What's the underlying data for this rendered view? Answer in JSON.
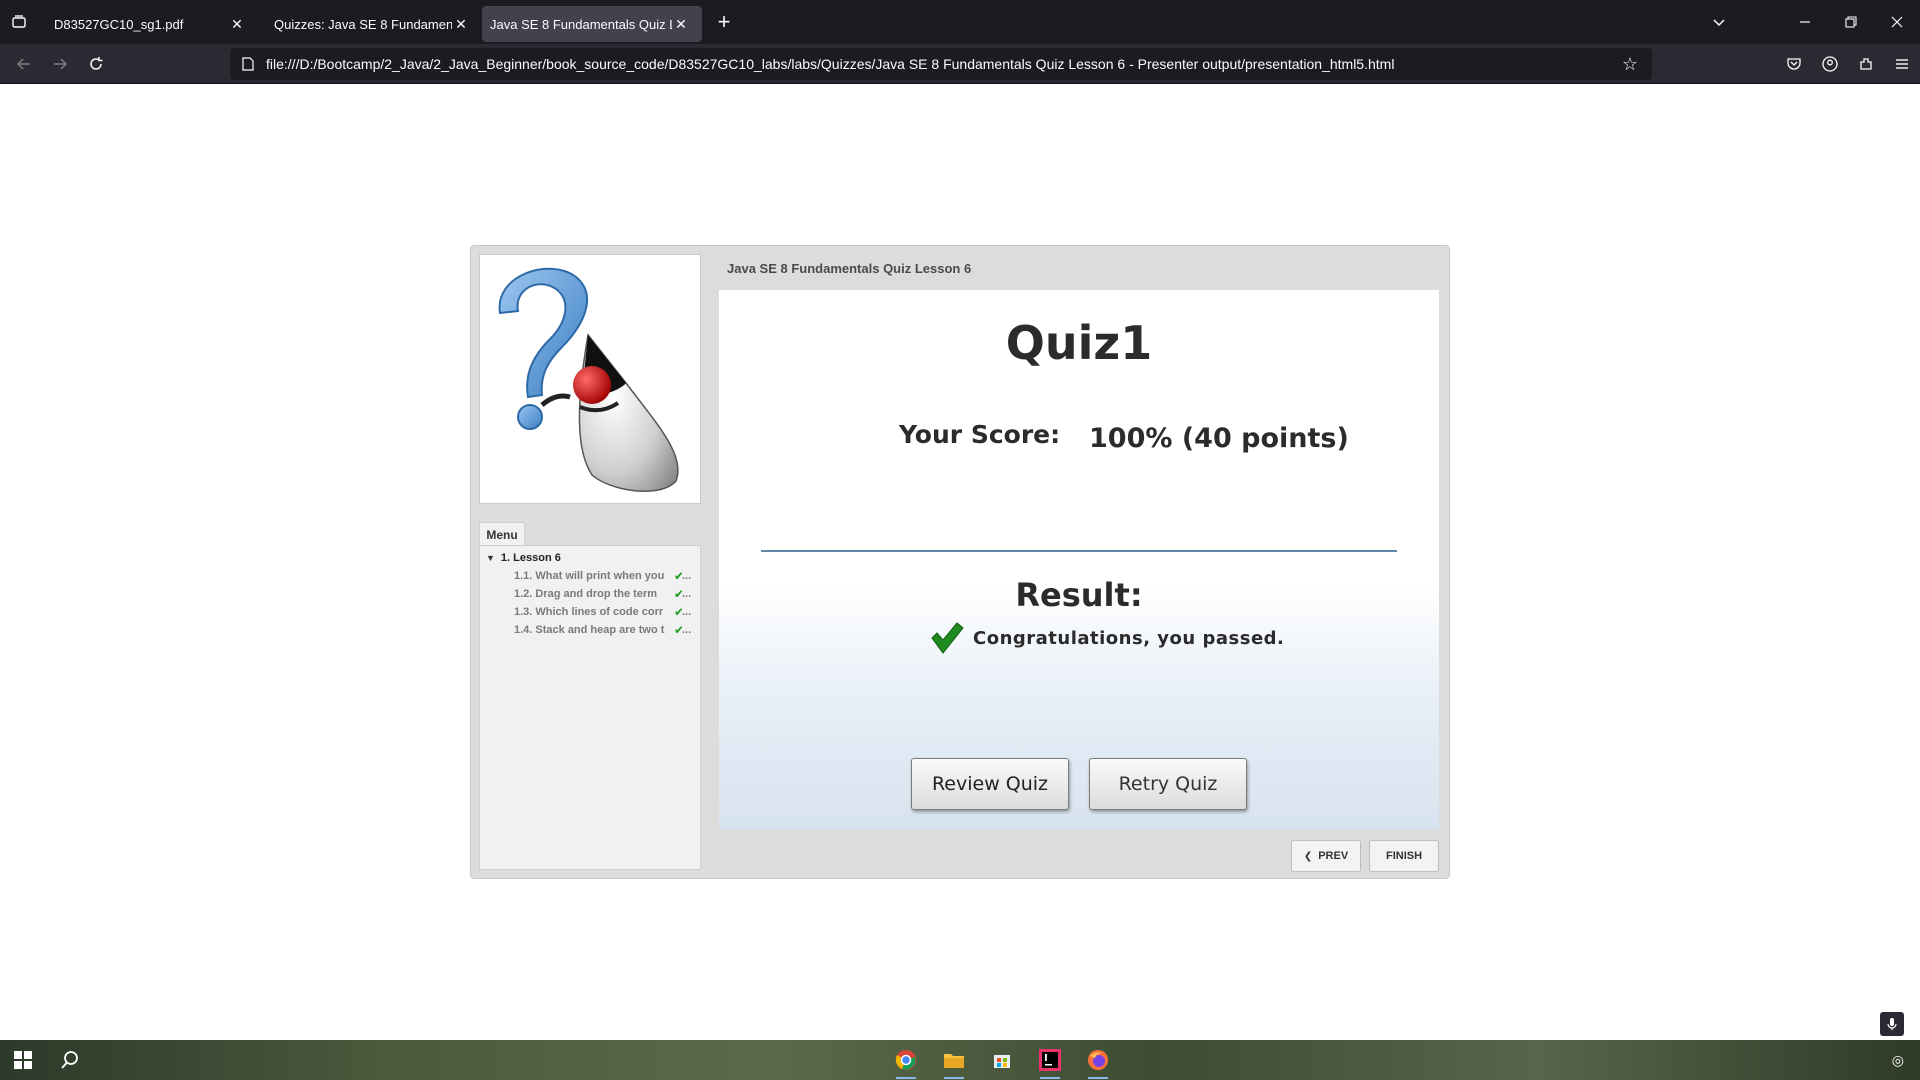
{
  "browser": {
    "tabs": [
      {
        "title": "D83527GC10_sg1.pdf",
        "active": false
      },
      {
        "title": "Quizzes: Java SE 8 Fundamentals",
        "active": false
      },
      {
        "title": "Java SE 8 Fundamentals Quiz Lesson 6",
        "active": true
      }
    ],
    "url": "file:///D:/Bootcamp/2_Java/2_Java_Beginner/book_source_code/D83527GC10_labs/labs/Quizzes/Java SE 8 Fundamentals Quiz Lesson 6 - Presenter output/presentation_html5.html"
  },
  "player": {
    "slide_title": "Java SE 8 Fundamentals Quiz Lesson 6",
    "menu": {
      "tab_label": "Menu",
      "lesson": "1. Lesson 6",
      "items": [
        {
          "label": "1.1. What will print when you",
          "completed": true
        },
        {
          "label": "1.2. Drag and drop the term",
          "completed": true
        },
        {
          "label": "1.3. Which lines of code corr",
          "completed": true
        },
        {
          "label": "1.4. Stack and heap are two t",
          "completed": true
        }
      ]
    },
    "slide": {
      "title": "Quiz1",
      "score_label": "Your Score:",
      "score_value": "100% (40 points)",
      "result_label": "Result:",
      "result_message": "Congratulations, you passed.",
      "review_button": "Review Quiz",
      "retry_button": "Retry Quiz"
    },
    "footer": {
      "prev_label": "PREV",
      "finish_label": "FINISH"
    }
  },
  "colors": {
    "browser_tabbar": "#1c1b22",
    "browser_toolbar": "#2b2a33",
    "check_green": "#1a9b1a",
    "divider_blue": "#5f87aa"
  },
  "taskbar": {
    "pinned": [
      "chrome-icon",
      "file-explorer-icon",
      "store-icon",
      "intellij-icon",
      "firefox-icon"
    ]
  }
}
